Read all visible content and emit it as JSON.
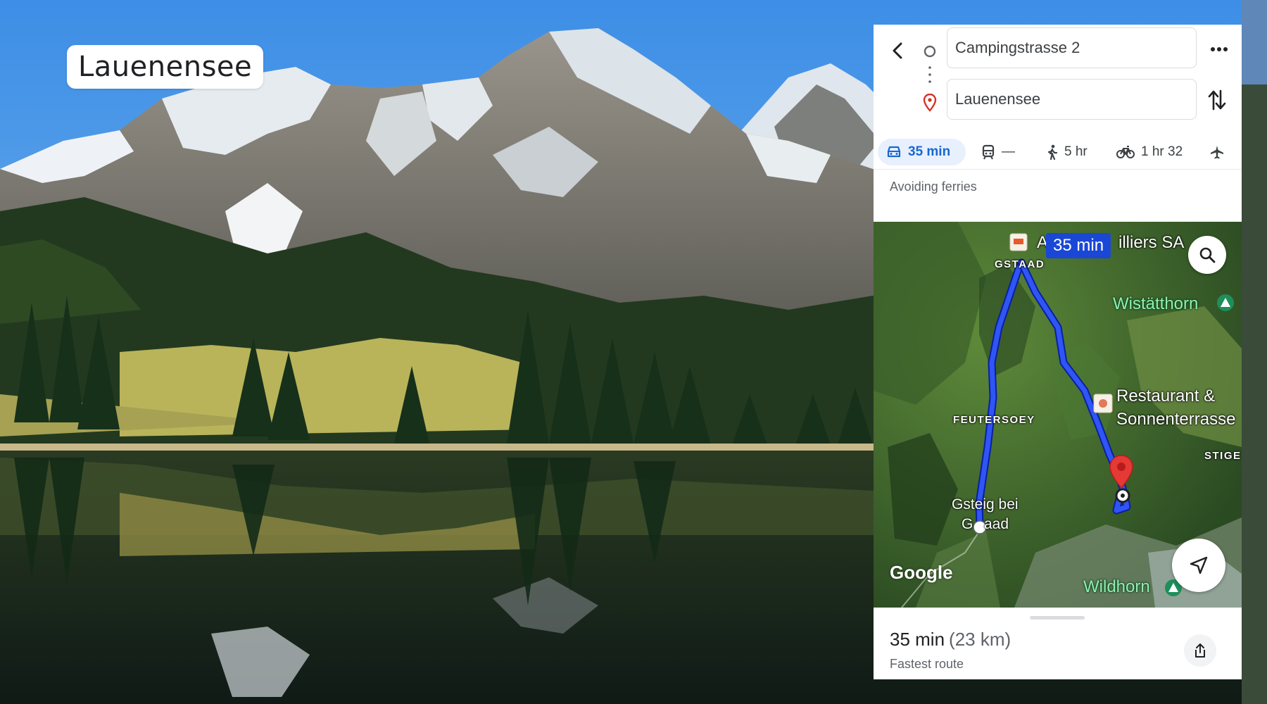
{
  "overlay": {
    "place_title": "Lauenensee"
  },
  "directions": {
    "origin": "Campingstrasse 2",
    "destination": "Lauenensee",
    "modes": [
      {
        "name": "Driving",
        "value": "35 min",
        "icon": "car-icon",
        "selected": true
      },
      {
        "name": "Transit",
        "value": "—",
        "icon": "train-icon",
        "selected": false
      },
      {
        "name": "Walking",
        "value": "5 hr",
        "icon": "walk-icon",
        "selected": false
      },
      {
        "name": "Cycling",
        "value": "1 hr 32",
        "icon": "bike-icon",
        "selected": false
      },
      {
        "name": "Flights",
        "value": "",
        "icon": "plane-icon",
        "selected": false
      }
    ],
    "route_option": "Avoiding ferries"
  },
  "map": {
    "duration_badge": "35 min",
    "labels": {
      "poi_top_left": "A",
      "poi_top_right": "illiers SA",
      "town_gstaad": "GSTAAD",
      "peak_wistatthorn": "Wistätthorn",
      "town_feutersoey": "FEUTERSOEY",
      "restaurant_line1": "Restaurant &",
      "restaurant_line2": "Sonnenterrasse",
      "town_stige": "STIGE",
      "village_line1": "Gsteig bei",
      "village_line2_left": "G",
      "village_line2_right": "aad",
      "peak_wildhorn": "Wildhorn",
      "attribution": "Google"
    },
    "route_color": "#2f55f5",
    "destination_pin_color": "#e53935"
  },
  "summary": {
    "duration": "35 min",
    "distance": "(23 km)",
    "subtitle": "Fastest route"
  },
  "colors": {
    "accent": "#1967d2",
    "selected_mode_bg": "#e8f0fe",
    "badge_bg": "#1a47d6"
  }
}
